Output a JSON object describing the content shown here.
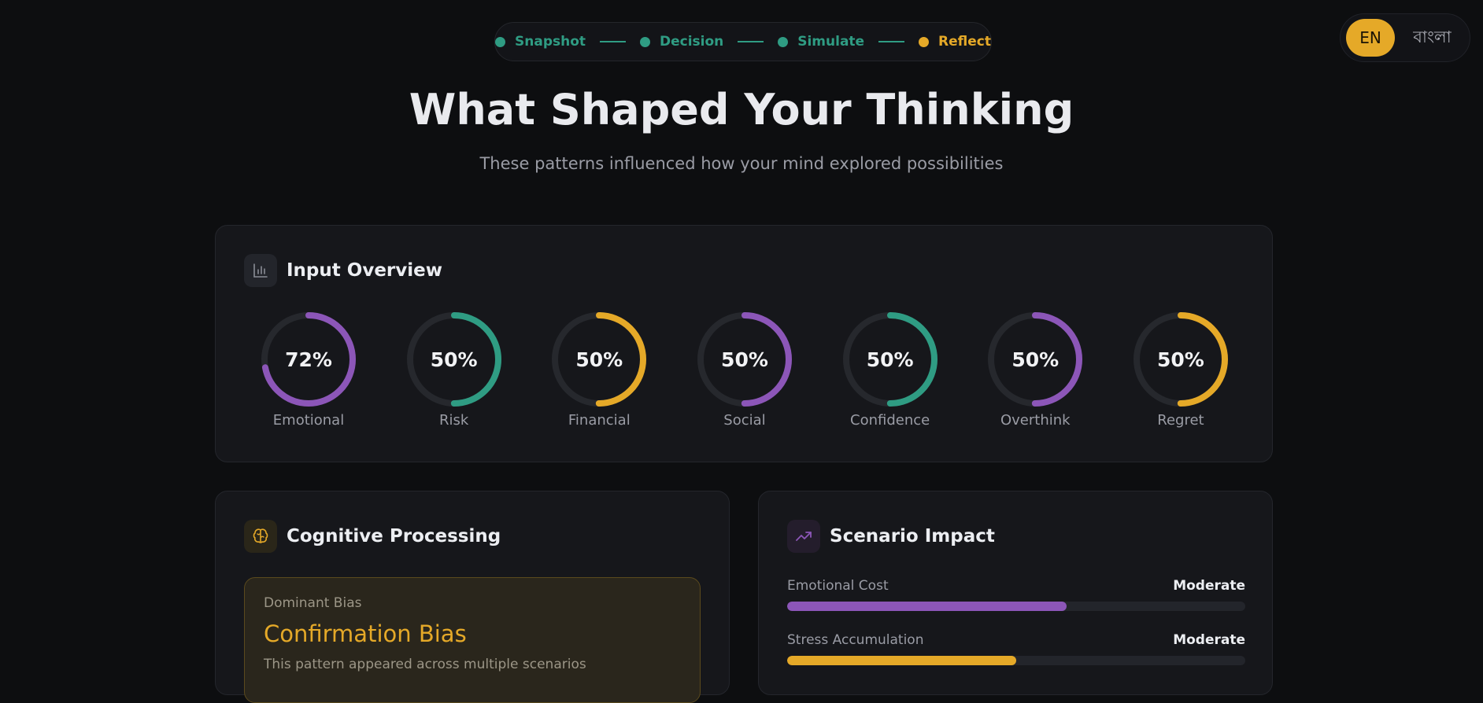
{
  "stepper": {
    "steps": [
      {
        "label": "Snapshot",
        "state": "done"
      },
      {
        "label": "Decision",
        "state": "done"
      },
      {
        "label": "Simulate",
        "state": "done"
      },
      {
        "label": "Reflect",
        "state": "active"
      }
    ]
  },
  "language": {
    "selected": "EN",
    "alternate": "বাংলা"
  },
  "header": {
    "title": "What Shaped Your Thinking",
    "subtitle": "These patterns influenced how your mind explored possibilities"
  },
  "input_overview": {
    "title": "Input Overview",
    "icon": "bar-chart-icon",
    "gauges": [
      {
        "label": "Emotional",
        "percent_text": "72%",
        "value": 72,
        "color": "#8c56b8"
      },
      {
        "label": "Risk",
        "percent_text": "50%",
        "value": 50,
        "color": "#2f9c83"
      },
      {
        "label": "Financial",
        "percent_text": "50%",
        "value": 50,
        "color": "#e5a928"
      },
      {
        "label": "Social",
        "percent_text": "50%",
        "value": 50,
        "color": "#8c56b8"
      },
      {
        "label": "Confidence",
        "percent_text": "50%",
        "value": 50,
        "color": "#2f9c83"
      },
      {
        "label": "Overthink",
        "percent_text": "50%",
        "value": 50,
        "color": "#8c56b8"
      },
      {
        "label": "Regret",
        "percent_text": "50%",
        "value": 50,
        "color": "#e5a928"
      }
    ]
  },
  "cognitive": {
    "title": "Cognitive Processing",
    "icon": "brain-icon",
    "bias_label": "Dominant Bias",
    "bias_name": "Confirmation Bias",
    "bias_desc": "This pattern appeared across multiple scenarios"
  },
  "scenario": {
    "title": "Scenario Impact",
    "icon": "trending-up-icon",
    "metrics": [
      {
        "label": "Emotional Cost",
        "value": "Moderate",
        "fill_percent": 61,
        "color": "#8c56b8"
      },
      {
        "label": "Stress Accumulation",
        "value": "Moderate",
        "fill_percent": 50,
        "color": "#e5a928"
      }
    ]
  },
  "colors": {
    "accent_gold": "#e5a928",
    "accent_teal": "#2f9c83",
    "accent_purple": "#8c56b8",
    "background": "#0d0e10",
    "card": "#16171b"
  }
}
